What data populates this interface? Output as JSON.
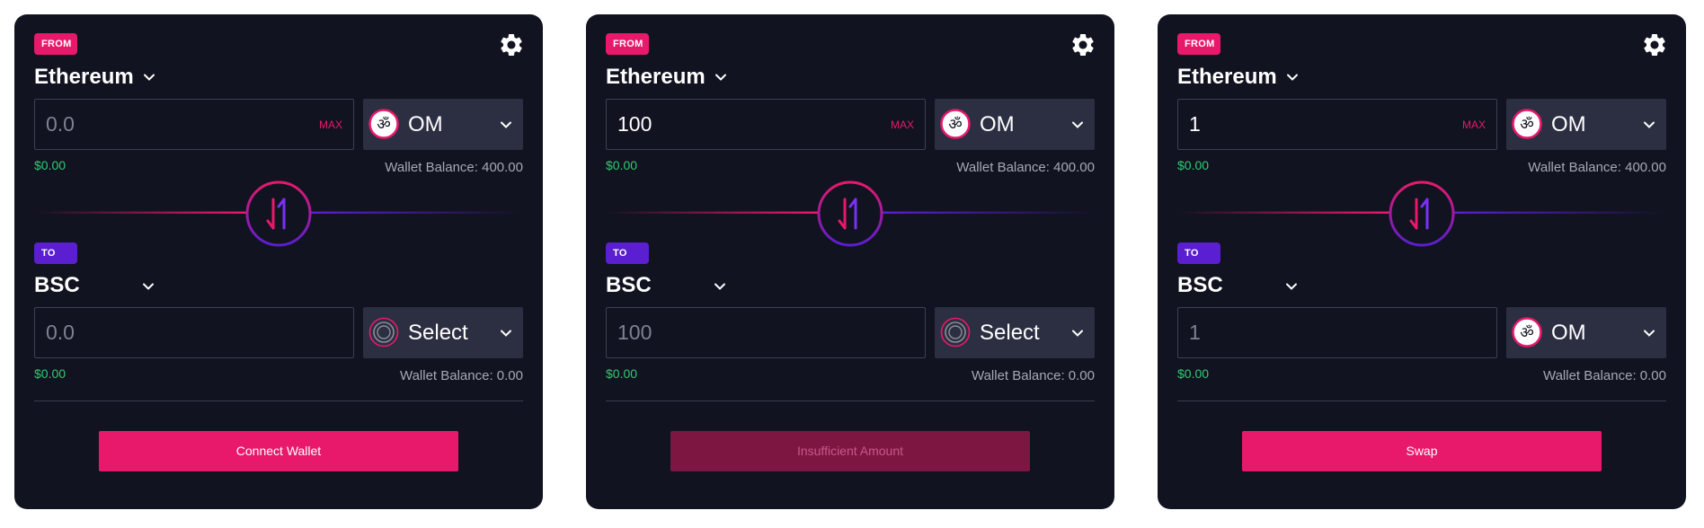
{
  "colors": {
    "card_bg": "#111320",
    "accent_pink": "#e8196b",
    "accent_purple": "#5b1ed0",
    "usd_green": "#2ecc71",
    "action_disabled_bg": "#7e1642",
    "action_disabled_text": "#c4598a"
  },
  "icons": {
    "settings": "gear-icon",
    "dropdown": "chevron-down-icon",
    "om_token": "om-token-icon",
    "select_token": "placeholder-token-icon",
    "swap_direction": "swap-arrows-icon"
  },
  "panels": [
    {
      "from": {
        "badge": "FROM",
        "network": "Ethereum",
        "amount": "0.0",
        "amount_is_placeholder": true,
        "max_label": "MAX",
        "token": "OM",
        "token_icon": "om",
        "usd_value": "$0.00",
        "wallet_balance": "Wallet Balance: 400.00"
      },
      "to": {
        "badge": "TO",
        "network": "BSC",
        "amount": "0.0",
        "amount_is_placeholder": true,
        "token": "Select",
        "token_icon": "select",
        "usd_value": "$0.00",
        "wallet_balance": "Wallet Balance: 0.00"
      },
      "action": {
        "label": "Connect Wallet",
        "state": "enabled"
      }
    },
    {
      "from": {
        "badge": "FROM",
        "network": "Ethereum",
        "amount": "100",
        "amount_is_placeholder": false,
        "max_label": "MAX",
        "token": "OM",
        "token_icon": "om",
        "usd_value": "$0.00",
        "wallet_balance": "Wallet Balance: 400.00"
      },
      "to": {
        "badge": "TO",
        "network": "BSC",
        "amount": "100",
        "amount_is_placeholder": true,
        "token": "Select",
        "token_icon": "select",
        "usd_value": "$0.00",
        "wallet_balance": "Wallet Balance: 0.00"
      },
      "action": {
        "label": "Insufficient Amount",
        "state": "disabled"
      }
    },
    {
      "from": {
        "badge": "FROM",
        "network": "Ethereum",
        "amount": "1",
        "amount_is_placeholder": false,
        "max_label": "MAX",
        "token": "OM",
        "token_icon": "om",
        "usd_value": "$0.00",
        "wallet_balance": "Wallet Balance: 400.00"
      },
      "to": {
        "badge": "TO",
        "network": "BSC",
        "amount": "1",
        "amount_is_placeholder": true,
        "token": "OM",
        "token_icon": "om",
        "usd_value": "$0.00",
        "wallet_balance": "Wallet Balance: 0.00"
      },
      "action": {
        "label": "Swap",
        "state": "enabled"
      }
    }
  ]
}
